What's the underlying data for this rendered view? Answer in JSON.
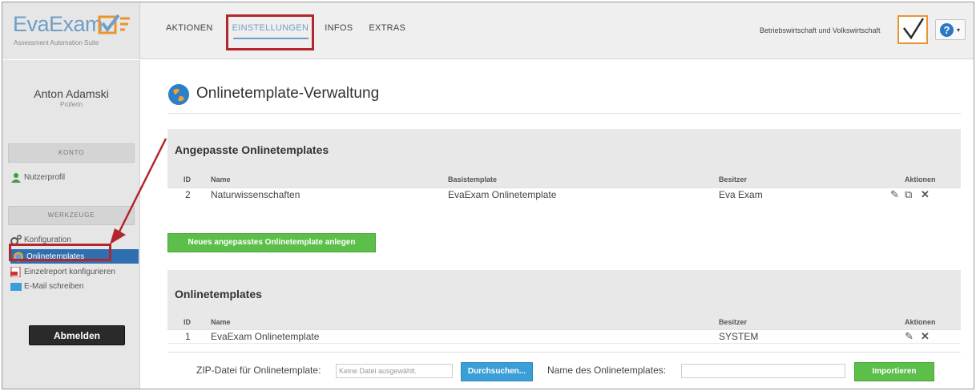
{
  "app": {
    "logo_text": "EvaExam",
    "logo_sub": "Assessment Automation Suite",
    "faculty": "Betriebswirtschaft und Volkswirtschaft",
    "help_glyph": "?",
    "help_caret": "▾"
  },
  "nav": {
    "items": [
      "AKTIONEN",
      "EINSTELLUNGEN",
      "INFOS",
      "EXTRAS"
    ],
    "active": "EINSTELLUNGEN"
  },
  "sidebar": {
    "user_name": "Anton Adamski",
    "user_role": "Prüferin",
    "section_konto": "KONTO",
    "nutzerprofil": "Nutzerprofil",
    "section_werkzeuge": "WERKZEUGE",
    "tools": [
      {
        "label": "Konfiguration",
        "icon": "gears-icon"
      },
      {
        "label": "Onlinetemplates",
        "icon": "globe-icon"
      },
      {
        "label": "Einzelreport konfigurieren",
        "icon": "pdf-icon"
      },
      {
        "label": "E-Mail schreiben",
        "icon": "mail-icon"
      }
    ],
    "logout": "Abmelden"
  },
  "main": {
    "title": "Onlinetemplate-Verwaltung",
    "custom": {
      "title": "Angepasste Onlinetemplates",
      "headers": {
        "id": "ID",
        "name": "Name",
        "base": "Basistemplate",
        "owner": "Besitzer",
        "actions": "Aktionen"
      },
      "rows": [
        {
          "id": "2",
          "name": "Naturwissenschaften",
          "base": "EvaExam Onlinetemplate",
          "owner": "Eva Exam"
        }
      ]
    },
    "new_button": "Neues angepasstes Onlinetemplate anlegen",
    "templates": {
      "title": "Onlinetemplates",
      "headers": {
        "id": "ID",
        "name": "Name",
        "owner": "Besitzer",
        "actions": "Aktionen"
      },
      "rows": [
        {
          "id": "1",
          "name": "EvaExam Onlinetemplate",
          "owner": "SYSTEM"
        }
      ]
    },
    "import": {
      "zip_label": "ZIP-Datei für Onlinetemplate:",
      "file_value": "Keine Datei ausgewählt.",
      "browse": "Durchsuchen...",
      "name_label": "Name des Onlinetemplates:",
      "name_value": "",
      "import_button": "Importieren"
    }
  },
  "colors": {
    "accent": "#6f9ec9",
    "highlight": "#b3262b",
    "active_side": "#2f6fb0",
    "green": "#5cbf4a",
    "blue": "#3a9fd8"
  }
}
